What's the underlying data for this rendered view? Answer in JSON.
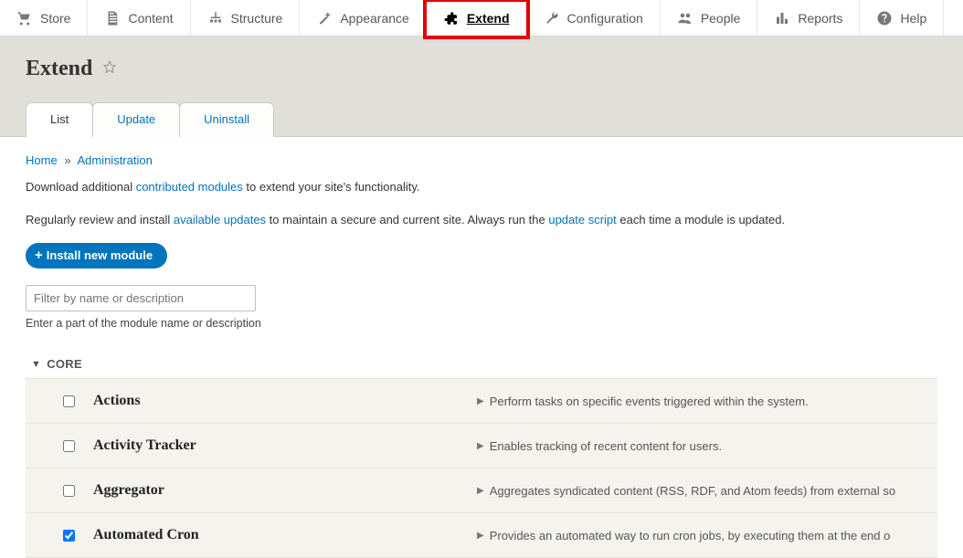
{
  "topnav": [
    {
      "id": "store",
      "label": "Store"
    },
    {
      "id": "content",
      "label": "Content"
    },
    {
      "id": "structure",
      "label": "Structure"
    },
    {
      "id": "appearance",
      "label": "Appearance"
    },
    {
      "id": "extend",
      "label": "Extend",
      "active": true
    },
    {
      "id": "configuration",
      "label": "Configuration"
    },
    {
      "id": "people",
      "label": "People"
    },
    {
      "id": "reports",
      "label": "Reports"
    },
    {
      "id": "help",
      "label": "Help"
    }
  ],
  "page": {
    "title": "Extend"
  },
  "tabs": [
    {
      "id": "list",
      "label": "List",
      "active": true
    },
    {
      "id": "update",
      "label": "Update"
    },
    {
      "id": "uninstall",
      "label": "Uninstall"
    }
  ],
  "breadcrumb": {
    "home": "Home",
    "admin": "Administration",
    "sep": "»"
  },
  "intro1": {
    "pre": "Download additional ",
    "link": "contributed modules",
    "post": " to extend your site's functionality."
  },
  "intro2": {
    "pre": "Regularly review and install ",
    "link1": "available updates",
    "mid": " to maintain a secure and current site. Always run the ",
    "link2": "update script",
    "post": " each time a module is updated."
  },
  "install_button": "Install new module",
  "filter": {
    "placeholder": "Filter by name or description",
    "note": "Enter a part of the module name or description"
  },
  "group": {
    "name": "CORE"
  },
  "modules": [
    {
      "name": "Actions",
      "desc": "Perform tasks on specific events triggered within the system.",
      "checked": false,
      "dotted": false
    },
    {
      "name": "Activity Tracker",
      "desc": "Enables tracking of recent content for users.",
      "checked": false,
      "dotted": false
    },
    {
      "name": "Aggregator",
      "desc": "Aggregates syndicated content (RSS, RDF, and Atom feeds) from external so",
      "checked": false,
      "dotted": true
    },
    {
      "name": "Automated Cron",
      "desc": "Provides an automated way to run cron jobs, by executing them at the end o",
      "checked": true,
      "dotted": false
    }
  ]
}
